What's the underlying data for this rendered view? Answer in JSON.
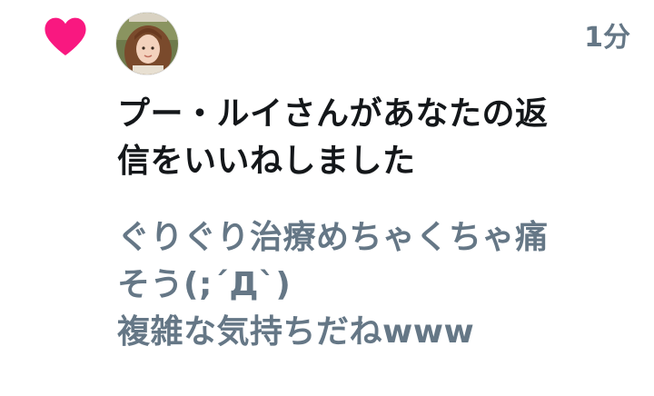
{
  "notification": {
    "type_icon": "heart-icon",
    "accent_color": "#f91880",
    "avatar": "user-avatar",
    "timestamp": "1分",
    "message_lines": [
      "プー・ルイさんがあなたの返",
      "信をいいねしました"
    ],
    "quoted_lines": [
      "ぐりぐり治療めちゃくちゃ痛",
      "そう(;´Д`)",
      "複雑な気持ちだねwww"
    ]
  }
}
